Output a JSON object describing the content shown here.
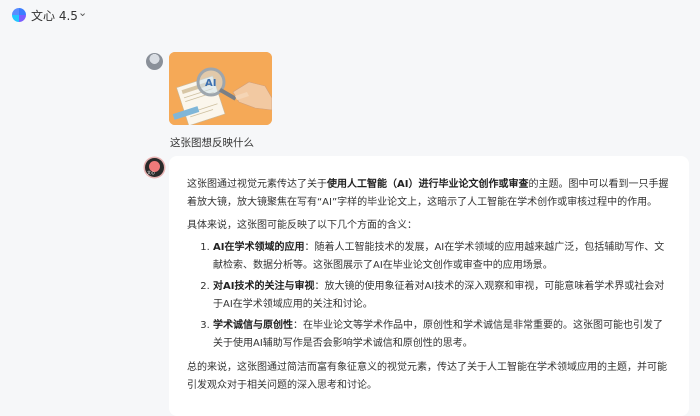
{
  "header": {
    "app_title": "文心 4.5",
    "model_chevron_icon": "chevron-down-icon"
  },
  "user_message": {
    "question": "这张图想反映什么"
  },
  "bot_message": {
    "intro_before": "这张图通过视觉元素传达了关于",
    "intro_bold": "使用人工智能（AI）进行毕业论文创作或审查",
    "intro_after": "的主题。图中可以看到一只手握着放大镜，放大镜聚焦在写有“AI”字样的毕业论文上，这暗示了人工智能在学术创作或审核过程中的作用。",
    "lead": "具体来说，这张图可能反映了以下几个方面的含义：",
    "points": [
      {
        "title": "AI在学术领域的应用",
        "text": "：随着人工智能技术的发展，AI在学术领域的应用越来越广泛，包括辅助写作、文献检索、数据分析等。这张图展示了AI在毕业论文创作或审查中的应用场景。"
      },
      {
        "title": "对AI技术的关注与审视",
        "text": "：放大镜的使用象征着对AI技术的深入观察和审视，可能意味着学术界或社会对于AI在学术领域应用的关注和讨论。"
      },
      {
        "title": "学术诚信与原创性",
        "text": "：在毕业论文等学术作品中，原创性和学术诚信是非常重要的。这张图可能也引发了关于使用AI辅助写作是否会影响学术诚信和原创性的思考。"
      }
    ],
    "conclusion": "总的来说，这张图通过简洁而富有象征意义的视觉元素，传达了关于人工智能在学术领域应用的主题，并可能引发观众对于相关问题的深入思考和讨论。",
    "avatar_tag": "文心"
  },
  "colors": {
    "image_bg": "#f4a957",
    "card_bg": "#ffffff",
    "page_bg": "#f6f7f9"
  }
}
